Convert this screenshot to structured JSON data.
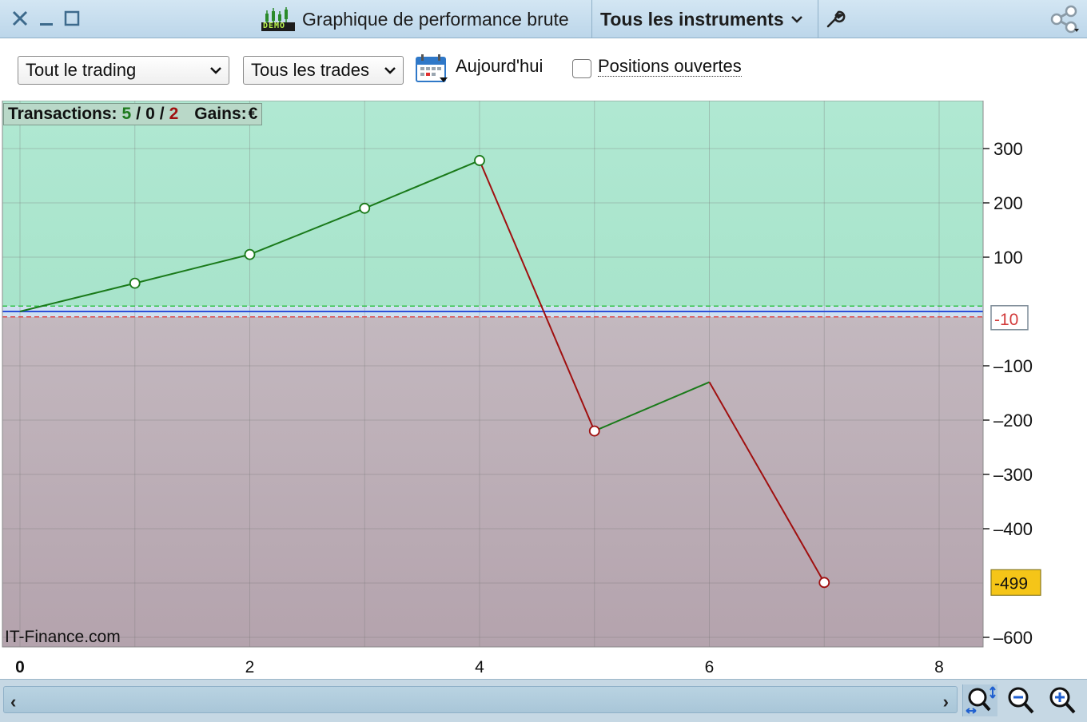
{
  "window": {
    "title": "Graphique de performance brute",
    "badge": "DEMO",
    "instrument_selector": "Tous les instruments"
  },
  "toolbar": {
    "trading_filter": "Tout le trading",
    "trades_filter": "Tous les trades",
    "date_label": "Aujourd'hui",
    "open_positions_label": "Positions ouvertes",
    "open_positions_checked": false
  },
  "summary": {
    "label": "Transactions:",
    "won": "5",
    "sep1": "/",
    "even": "0",
    "sep2": "/",
    "lost": "2",
    "gains_label": "Gains:",
    "currency": "€"
  },
  "watermark": "IT-Finance.com",
  "colors": {
    "gain_zone": "#a8e4cb",
    "loss_zone": "#b4a3ad",
    "gain_line": "#1a7a1a",
    "loss_line": "#a01010",
    "last_value_badge": "#f5c518"
  },
  "chart_data": {
    "type": "line",
    "x": [
      0,
      1,
      2,
      3,
      4,
      5,
      6,
      7
    ],
    "values": [
      0,
      52,
      105,
      190,
      278,
      -220,
      -130,
      -499
    ],
    "x_ticks": [
      "0",
      "2",
      "4",
      "6",
      "8"
    ],
    "y_ticks": [
      "300",
      "200",
      "100",
      "–100",
      "–200",
      "–300",
      "–400",
      "–600"
    ],
    "xlim": [
      0,
      8.4
    ],
    "ylim": [
      -620,
      395
    ],
    "upper_threshold": 10,
    "lower_threshold": -10,
    "lower_threshold_label": "-10",
    "last_value_label": "-499",
    "grid": true
  },
  "icons": {
    "close": "close-icon",
    "minimize": "minimize-icon",
    "maximize": "maximize-icon",
    "wrench": "wrench-icon",
    "share": "share-icon",
    "calendar": "calendar-icon",
    "zoom_fit": "zoom-fit-icon",
    "zoom_out": "zoom-out-icon",
    "zoom_in": "zoom-in-icon"
  }
}
